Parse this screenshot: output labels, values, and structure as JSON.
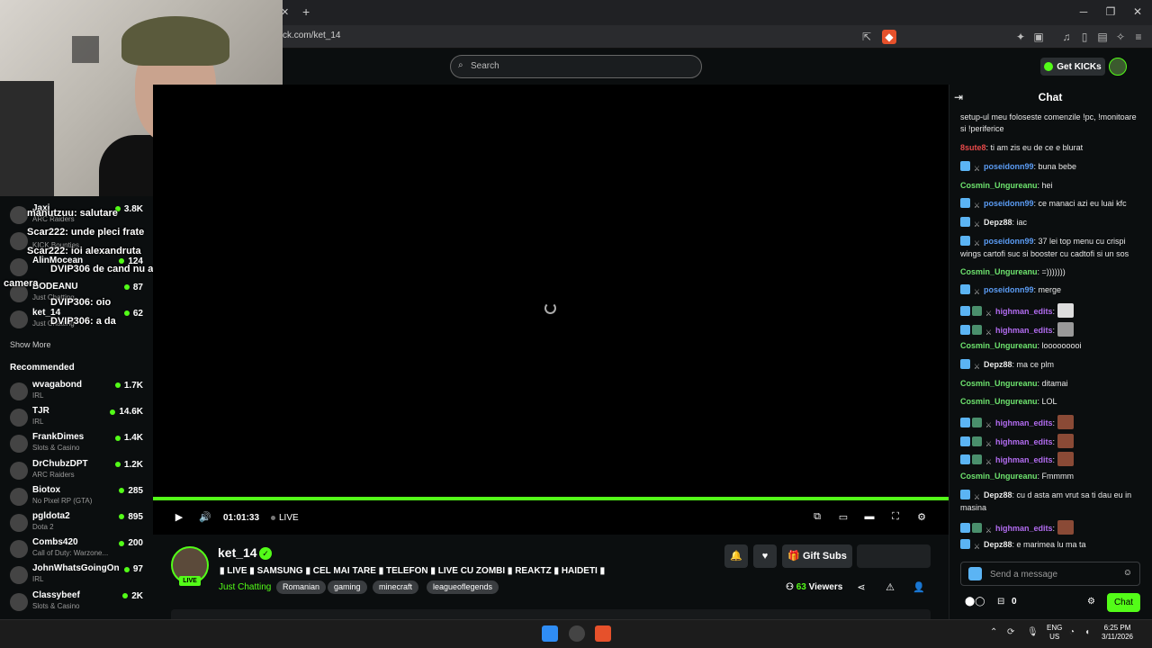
{
  "browser": {
    "url": "ck.com/ket_14",
    "tab_close": "✕",
    "new_tab": "+",
    "min": "─",
    "restore": "❐",
    "close": "✕"
  },
  "header": {
    "search_placeholder": "Search",
    "get_kicks_label": "Get KICKs"
  },
  "sidebar": {
    "following": [
      {
        "name": "Jaxi",
        "category": "ARC Raiders",
        "viewers": "3.8K"
      },
      {
        "name": "",
        "category": "KICK Bounties",
        "viewers": ""
      },
      {
        "name": "AlinMocean",
        "category": "",
        "viewers": "124"
      },
      {
        "name": "BODEANU",
        "category": "Just Chatting",
        "viewers": "87"
      },
      {
        "name": "ket_14",
        "category": "Just Chatting",
        "viewers": "62"
      }
    ],
    "show_more": "Show More",
    "recommended_title": "Recommended",
    "recommended": [
      {
        "name": "wvagabond",
        "category": "IRL",
        "viewers": "1.7K"
      },
      {
        "name": "TJR",
        "category": "IRL",
        "viewers": "14.6K"
      },
      {
        "name": "FrankDimes",
        "category": "Slots & Casino",
        "viewers": "1.4K"
      },
      {
        "name": "DrChubzDPT",
        "category": "ARC Raiders",
        "viewers": "1.2K"
      },
      {
        "name": "Biotox",
        "category": "No Pixel RP (GTA)",
        "viewers": "285"
      },
      {
        "name": "pgldota2",
        "category": "Dota 2",
        "viewers": "895"
      },
      {
        "name": "Combs420",
        "category": "Call of Duty: Warzone...",
        "viewers": "200"
      },
      {
        "name": "JohnWhatsGoingOn",
        "category": "IRL",
        "viewers": "97"
      },
      {
        "name": "Classybeef",
        "category": "Slots & Casino",
        "viewers": "2K"
      }
    ]
  },
  "overlay_chat": [
    {
      "user": "manutzuu:",
      "text": "salutare"
    },
    {
      "user": "Scar222:",
      "text": "unde pleci frate"
    },
    {
      "user": "Scar222:",
      "text": "ioi alexandruta"
    },
    {
      "user": "DVIP306",
      "text": "de cand nu am mai vazut lumina la tine in"
    },
    {
      "user": "",
      "text": "camera"
    },
    {
      "user": "DVIP306:",
      "text": "oio"
    },
    {
      "user": "DVIP306:",
      "text": "a da"
    }
  ],
  "player": {
    "time": "01:01:33",
    "live_label": "LIVE"
  },
  "stream": {
    "channel": "ket_14",
    "live_badge": "LIVE",
    "title": "▮ LIVE ▮ SAMSUNG ▮ CEL MAI TARE ▮ TELEFON ▮ LIVE CU ZOMBI ▮ REAKTZ ▮ HAIDETI ▮",
    "category": "Just Chatting",
    "tags": [
      "Romanian",
      "gaming",
      "minecraft",
      "leagueoflegends"
    ],
    "gift_subs": "Gift Subs",
    "viewers_num": "63",
    "viewers_label": "Viewers"
  },
  "chat": {
    "title": "Chat",
    "messages": [
      {
        "badges": 0,
        "user": "",
        "color": "#e8e8e8",
        "text": "setup-ul meu foloseste comenzile !pc, !monitoare si !periferice"
      },
      {
        "badges": 0,
        "user": "8sute8",
        "color": "#e84a4a",
        "text": ": ti am zis eu de ce e blurat"
      },
      {
        "badges": 2,
        "user": "poseidonn99",
        "color": "#5b9cf4",
        "text": ": buna bebe"
      },
      {
        "badges": 0,
        "user": "Cosmin_Ungureanu",
        "color": "#6ee36e",
        "text": ": hei"
      },
      {
        "badges": 2,
        "user": "poseidonn99",
        "color": "#5b9cf4",
        "text": ": ce manaci azi eu luai kfc"
      },
      {
        "badges": 2,
        "user": "Depz88",
        "color": "#e8e8e8",
        "text": ": iac"
      },
      {
        "badges": 2,
        "user": "poseidonn99",
        "color": "#5b9cf4",
        "text": ": 37 lei top menu cu crispi wings cartofi suc si booster cu cadtofi si un sos"
      },
      {
        "badges": 0,
        "user": "Cosmin_Ungureanu",
        "color": "#6ee36e",
        "text": ": =)))))))"
      },
      {
        "badges": 2,
        "user": "poseidonn99",
        "color": "#5b9cf4",
        "text": ": merge"
      },
      {
        "badges": 3,
        "user": "highman_edits",
        "color": "#b26cf0",
        "text": ":",
        "emote": "em2"
      },
      {
        "badges": 3,
        "user": "highman_edits",
        "color": "#b26cf0",
        "text": ":",
        "emote": "em3"
      },
      {
        "badges": 0,
        "user": "Cosmin_Ungureanu",
        "color": "#6ee36e",
        "text": ": looooooooi"
      },
      {
        "badges": 2,
        "user": "Depz88",
        "color": "#e8e8e8",
        "text": ": ma ce plm"
      },
      {
        "badges": 0,
        "user": "Cosmin_Ungureanu",
        "color": "#6ee36e",
        "text": ": ditamai"
      },
      {
        "badges": 0,
        "user": "Cosmin_Ungureanu",
        "color": "#6ee36e",
        "text": ": LOL"
      },
      {
        "badges": 3,
        "user": "highman_edits",
        "color": "#b26cf0",
        "text": ":",
        "emote": "em"
      },
      {
        "badges": 3,
        "user": "highman_edits",
        "color": "#b26cf0",
        "text": ":",
        "emote": "em"
      },
      {
        "badges": 3,
        "user": "highman_edits",
        "color": "#b26cf0",
        "text": ":",
        "emote": "em"
      },
      {
        "badges": 0,
        "user": "Cosmin_Ungureanu",
        "color": "#6ee36e",
        "text": ": Fmmmm"
      },
      {
        "badges": 2,
        "user": "Depz88",
        "color": "#e8e8e8",
        "text": ": cu d asta am vrut sa ti dau eu in masina"
      },
      {
        "badges": 3,
        "user": "highman_edits",
        "color": "#b26cf0",
        "text": ":",
        "emote": "em"
      },
      {
        "badges": 2,
        "user": "Depz88",
        "color": "#e8e8e8",
        "text": ": e marimea lu ma ta"
      }
    ],
    "input_placeholder": "Send a message",
    "kick_count": "0",
    "chat_button": "Chat"
  },
  "taskbar": {
    "lang_top": "ENG",
    "lang_bottom": "US",
    "time": "6:25 PM",
    "date": "3/11/2026"
  },
  "colors": {
    "accent": "#53fc18"
  }
}
